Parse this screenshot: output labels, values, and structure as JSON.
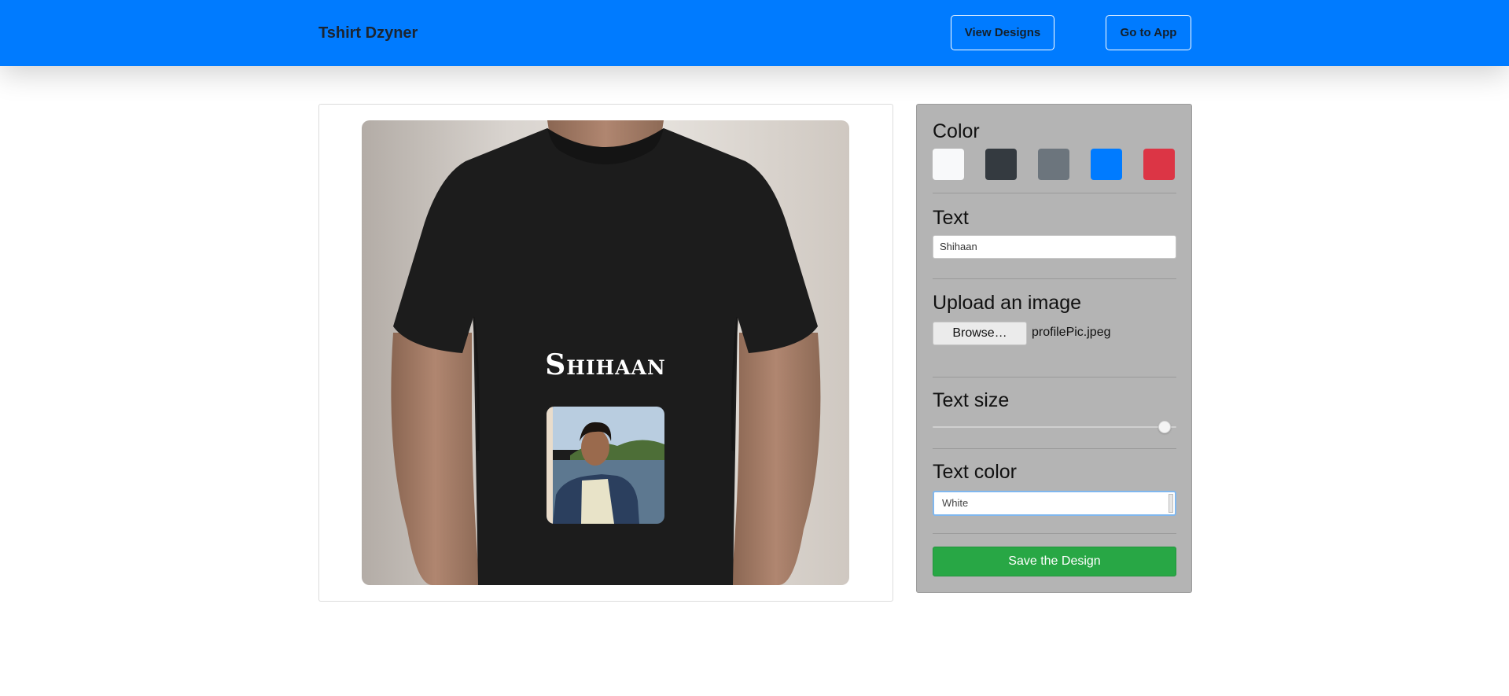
{
  "navbar": {
    "brand": "Tshirt Dzyner",
    "view_designs_label": "View Designs",
    "go_to_app_label": "Go to App",
    "background_color": "#007bff"
  },
  "preview": {
    "shirt_text": "Shihaan",
    "shirt_color": "#1c1c1c",
    "text_color": "#ffffff"
  },
  "panel": {
    "color_title": "Color",
    "swatches": [
      {
        "name": "white",
        "color": "#f8f9fa"
      },
      {
        "name": "dark",
        "color": "#343a40"
      },
      {
        "name": "gray",
        "color": "#6c757d"
      },
      {
        "name": "blue",
        "color": "#007bff"
      },
      {
        "name": "red",
        "color": "#dc3545"
      }
    ],
    "text_title": "Text",
    "text_value": "Shihaan",
    "upload_title": "Upload an image",
    "browse_label": "Browse…",
    "file_name": "profilePic.jpeg",
    "text_size_title": "Text size",
    "text_size_fraction": 0.95,
    "text_color_title": "Text color",
    "text_color_value": "White",
    "save_label": "Save the Design",
    "background_color": "#b4b4b4"
  }
}
